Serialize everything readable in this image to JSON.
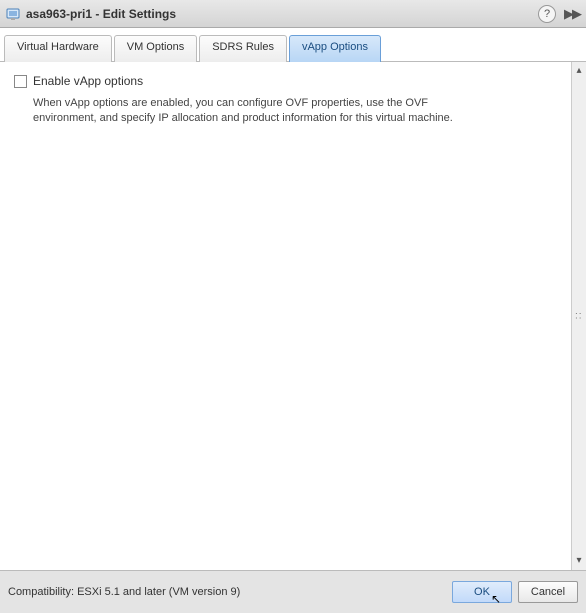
{
  "titlebar": {
    "vm_name": "asa963-pri1",
    "separator": " - ",
    "action": "Edit Settings"
  },
  "tabs": [
    {
      "label": "Virtual Hardware",
      "active": false
    },
    {
      "label": "VM Options",
      "active": false
    },
    {
      "label": "SDRS Rules",
      "active": false
    },
    {
      "label": "vApp Options",
      "active": true
    }
  ],
  "content": {
    "checkbox_label": "Enable vApp options",
    "checkbox_checked": false,
    "description": "When vApp options are enabled, you can configure OVF properties, use the OVF environment, and specify IP allocation and product information for this virtual machine."
  },
  "footer": {
    "compatibility_prefix": "Compatibility: ",
    "compatibility_value": "ESXi 5.1 and later (VM version 9)",
    "ok_label": "OK",
    "cancel_label": "Cancel"
  }
}
